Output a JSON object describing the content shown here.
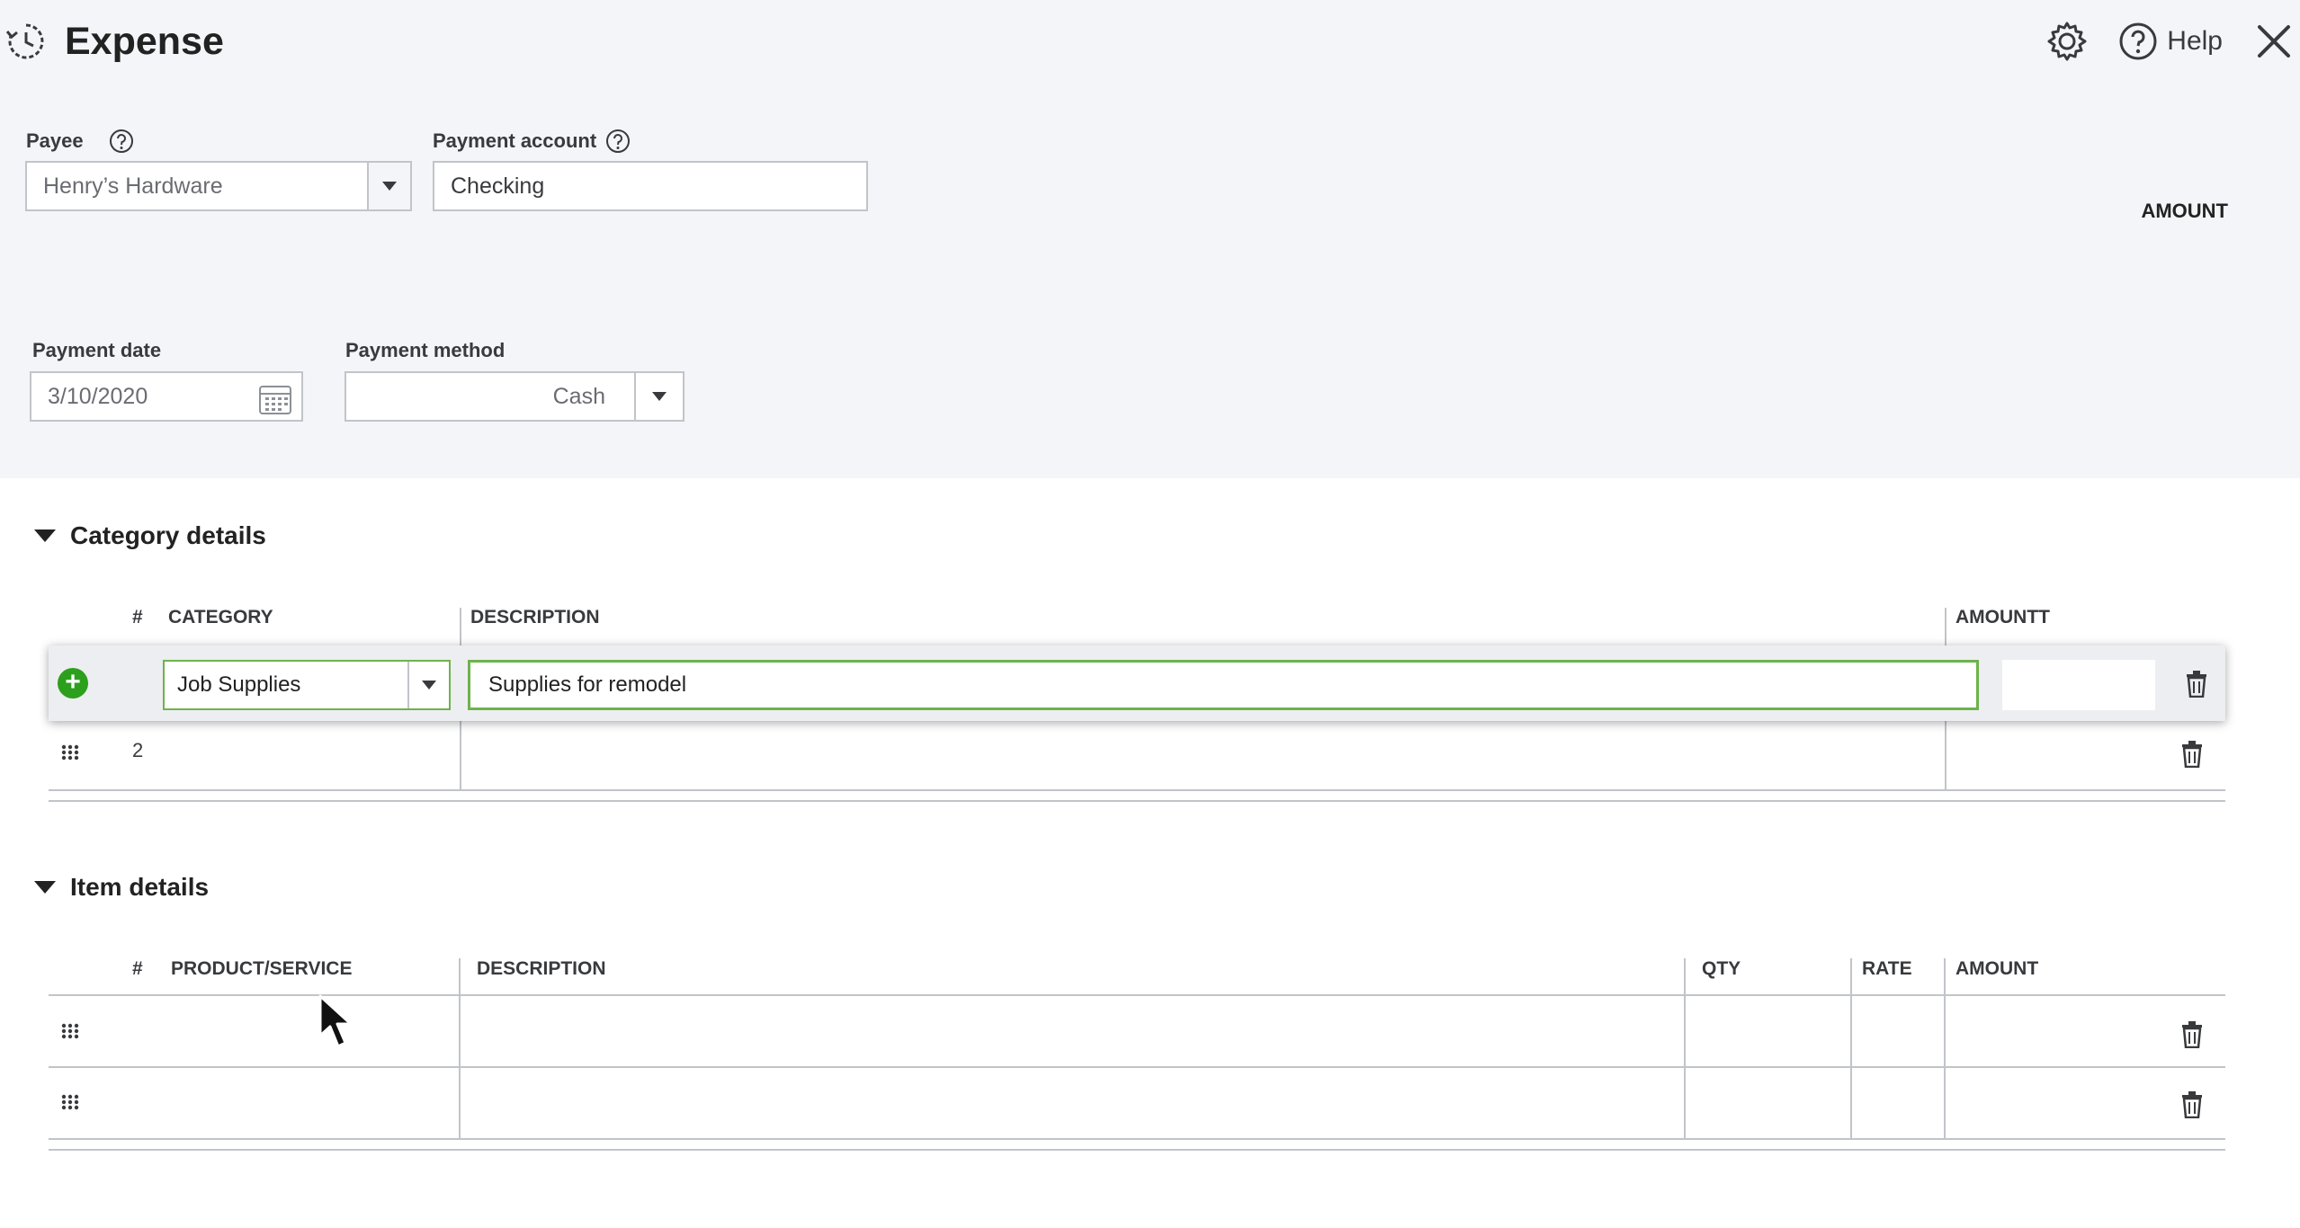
{
  "header": {
    "title": "Expense",
    "help_label": "Help"
  },
  "payee": {
    "label": "Payee",
    "value": "Henry’s Hardware"
  },
  "payment_account": {
    "label": "Payment account",
    "value": "Checking"
  },
  "amount_label": "AMOUNT",
  "payment_date": {
    "label": "Payment date",
    "value": "3/10/2020"
  },
  "payment_method": {
    "label": "Payment method",
    "value": "Cash"
  },
  "category_details": {
    "title": "Category details",
    "columns": {
      "num": "#",
      "category": "CATEGORY",
      "description": "DESCRIPTION",
      "amount": "AMOUNTT"
    },
    "rows": [
      {
        "category": "Job Supplies",
        "description": "Supplies for remodel"
      },
      {
        "num": "2"
      }
    ]
  },
  "item_details": {
    "title": "Item details",
    "columns": {
      "num": "#",
      "product": "PRODUCT/SERVICE",
      "description": "DESCRIPTION",
      "qty": "QTY",
      "rate": "RATE",
      "amount": "AMOUNT"
    }
  },
  "colors": {
    "accent_green": "#2ca01c",
    "focus_border": "#6db34c",
    "header_bg": "#f4f5f8"
  }
}
